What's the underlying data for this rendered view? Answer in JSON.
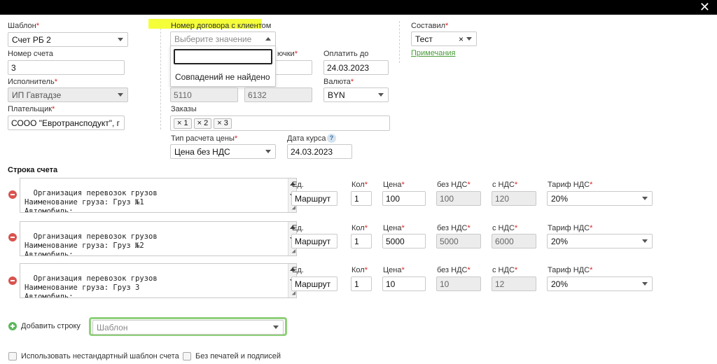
{
  "window": {
    "close_icon": "✕"
  },
  "fields": {
    "template": {
      "label": "Шаблон",
      "value": "Счет РБ 2"
    },
    "invoice_number": {
      "label": "Номер счета",
      "value": "3"
    },
    "executor": {
      "label": "Исполнитель",
      "value": "ИП Гавтадзе"
    },
    "payer": {
      "label": "Плательщик",
      "value": "СООО \"Евротрансподукт\", г"
    },
    "contract": {
      "label": "Номер договора с клиентом",
      "placeholder": "Выберите значение",
      "search_value": "",
      "no_match": "Совпадений не найдено"
    },
    "hidden_label_fragment": "ючки",
    "pay_until": {
      "label": "Оплатить до",
      "value": "24.03.2023"
    },
    "code_a": "5110",
    "code_b": "6132",
    "currency": {
      "label": "Валюта",
      "value": "BYN"
    },
    "orders": {
      "label": "Заказы",
      "tags": [
        "× 1",
        "× 2",
        "× 3"
      ]
    },
    "price_type": {
      "label": "Тип расчета цены",
      "value": "Цена без НДС"
    },
    "rate_date": {
      "label": "Дата курса",
      "value": "24.03.2023",
      "help": "?"
    },
    "composed_by": {
      "label": "Составил",
      "value": "Тест",
      "clear": "×"
    },
    "notes_link": "Примечания"
  },
  "lines": {
    "section_title": "Строка счета",
    "headers": {
      "unit": "Ед.",
      "qty": "Кол",
      "price": "Цена",
      "no_vat": "без НДС",
      "with_vat": "с НДС",
      "vat_rate": "Тариф НДС"
    },
    "rows": [
      {
        "text": "Организация перевозок грузов\nНаименование груза: Груз №1\nАвтомобиль:\nМаршрут перевозки: Софиа - Болгария - Спашарос - Болгария",
        "unit": "Маршрут",
        "qty": "1",
        "price": "100",
        "no_vat": "100",
        "with_vat": "120",
        "vat_rate": "20%"
      },
      {
        "text": "Организация перевозок грузов\nНаименование груза: Груз №2\nАвтомобиль:\nМаршрут перевозки: Стамбул - Азербайджан - Азербайджан",
        "unit": "Маршрут",
        "qty": "1",
        "price": "5000",
        "no_vat": "5000",
        "with_vat": "6000",
        "vat_rate": "20%"
      },
      {
        "text": "Организация перевозок грузов\nНаименование груза: Груз 3\nАвтомобиль:\nМаршрут перевозки: Минск - Беларусь - Стамбул - Азербайджан",
        "unit": "Маршрут",
        "qty": "1",
        "price": "10",
        "no_vat": "10",
        "with_vat": "12",
        "vat_rate": "20%"
      }
    ]
  },
  "add_row": {
    "label": "Добавить строку",
    "template_placeholder": "Шаблон"
  },
  "options": {
    "nonstandard_template": "Использовать нестандартный шаблон счета",
    "no_stamps": "Без печатей и подписей"
  },
  "colors": {
    "required": "#dd2222",
    "highlight": "#f4ff3a",
    "focus_green": "#8fd07a",
    "link_green": "#4a9d3a"
  }
}
